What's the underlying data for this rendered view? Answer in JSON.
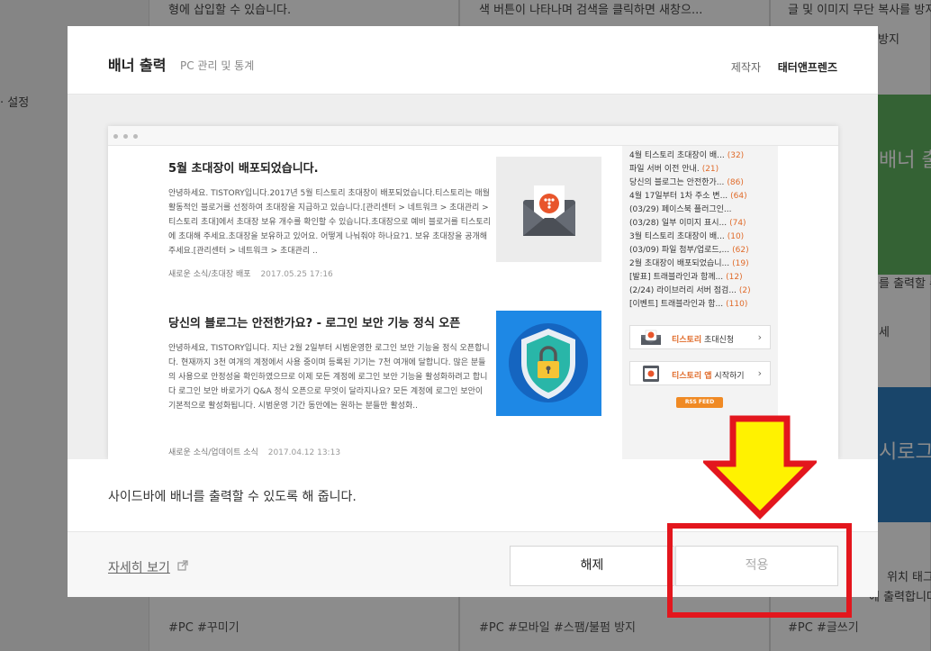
{
  "background": {
    "col1_top_text": "형에 삽입할 수 있습니다.",
    "col2_top_text": "색 버튼이 나타나며 검색을 클릭하면 새창으...",
    "col3_top_text": "글 및 이미지 무단 복사를 방지",
    "left_setting_text": "· 설정",
    "right_partial_1": "방지",
    "right_partial_2": "배너 출",
    "right_partial_3": "를 출력할 수",
    "right_partial_4": "세",
    "right_partial_5": "시로그",
    "right_partial_6": "위치 태그",
    "right_partial_7": "에 출력합니다.",
    "tags_1": "#PC  #꾸미기",
    "tags_2": "#PC  #모바일  #스팸/불펌 방지",
    "tags_3": "#PC  #글쓰기"
  },
  "modal": {
    "title": "배너 출력",
    "subtitle": "PC 관리 및 통계",
    "maker_label": "제작자",
    "maker_name": "태터앤프렌즈",
    "description": "사이드바에 배너를 출력할 수 있도록 해 줍니다.",
    "more_link": "자세히 보기",
    "release_button": "해제",
    "apply_button": "적용"
  },
  "preview": {
    "posts": [
      {
        "title": "5월 초대장이 배포되었습니다.",
        "body": "안녕하세요. TISTORY입니다.2017년 5월 티스토리 초대장이 배포되었습니다.티스토리는 매월 활동적인 블로거를 선정하여 초대장을 지급하고 있습니다.[관리센터 > 네트워크 > 초대관리 > 티스토리 초대]에서 초대장 보유 개수를 확인할 수 있습니다.초대장으로 예비 블로거를 티스토리에 초대해 주세요.초대장을 보유하고 있어요. 어떻게 나눠줘야 하나요?1. 보유 초대장을 공개해 주세요.[관리센터 > 네트워크 > 초대관리 ..",
        "category": "새로운 소식/초대장 배포",
        "date": "2017.05.25 17:16",
        "thumb_icon": "envelope-icon"
      },
      {
        "title": "당신의 블로그는 안전한가요? - 로그인 보안 기능 정식 오픈",
        "body": "안녕하세요, TISTORY입니다. 지난 2월 2일부터 시범운영한 로그인 보안 기능을 정식 오픈합니다. 현재까지 3천 여개의 계정에서 사용 중이며 등록된 기기는 7천 여개에 달합니다. 많은 분들의 사용으로 안정성을 확인하였으므로 이제 모든 계정에 로그인 보안 기능을 활성화하려고 합니다 로그인 보안 바로가기 Q&A 정식 오픈으로 무엇이 달라지나요? 모든 계정에 로그인 보안이 기본적으로 활성화됩니다. 시범운영 기간 동안에는 원하는 분들만 활성화..",
        "category": "새로운 소식/업데이트 소식",
        "date": "2017.04.12 13:13",
        "thumb_icon": "shield-lock-icon"
      }
    ],
    "sidebar_items": [
      {
        "text": "4월 티스토리 초대장이 배...",
        "count": "(32)"
      },
      {
        "text": "파일 서버 이전 안내.",
        "count": "(21)"
      },
      {
        "text": "당신의 블로그는 안전한가...",
        "count": "(86)"
      },
      {
        "text": "4월 17일부터 1차 주소 변...",
        "count": "(64)"
      },
      {
        "text": "(03/29) 페이스북 플러그인...",
        "count": ""
      },
      {
        "text": "(03/28) 일부 이미지 표시...",
        "count": "(74)"
      },
      {
        "text": "3월 티스토리 초대장이 배...",
        "count": "(10)"
      },
      {
        "text": "(03/09) 파일 첨부/업로드,...",
        "count": "(62)"
      },
      {
        "text": "2월 초대장이 배포되었습니...",
        "count": "(19)"
      },
      {
        "text": "[발표] 트래블라인과 함께...",
        "count": "(12)"
      },
      {
        "text": "(2/24) 라이브러리 서버 점검...",
        "count": "(2)"
      },
      {
        "text": "[이벤트] 트래블라인과 함...",
        "count": "(110)"
      }
    ],
    "banner1": {
      "accent": "티스토리",
      "rest": " 초대신청"
    },
    "banner2": {
      "accent": "티스토리 앱",
      "rest": " 시작하기"
    },
    "rss": "RSS FEED"
  },
  "colors": {
    "accent_orange": "#e06b2a",
    "annotation_red": "#e3161d",
    "annotation_yellow": "#fff200"
  }
}
